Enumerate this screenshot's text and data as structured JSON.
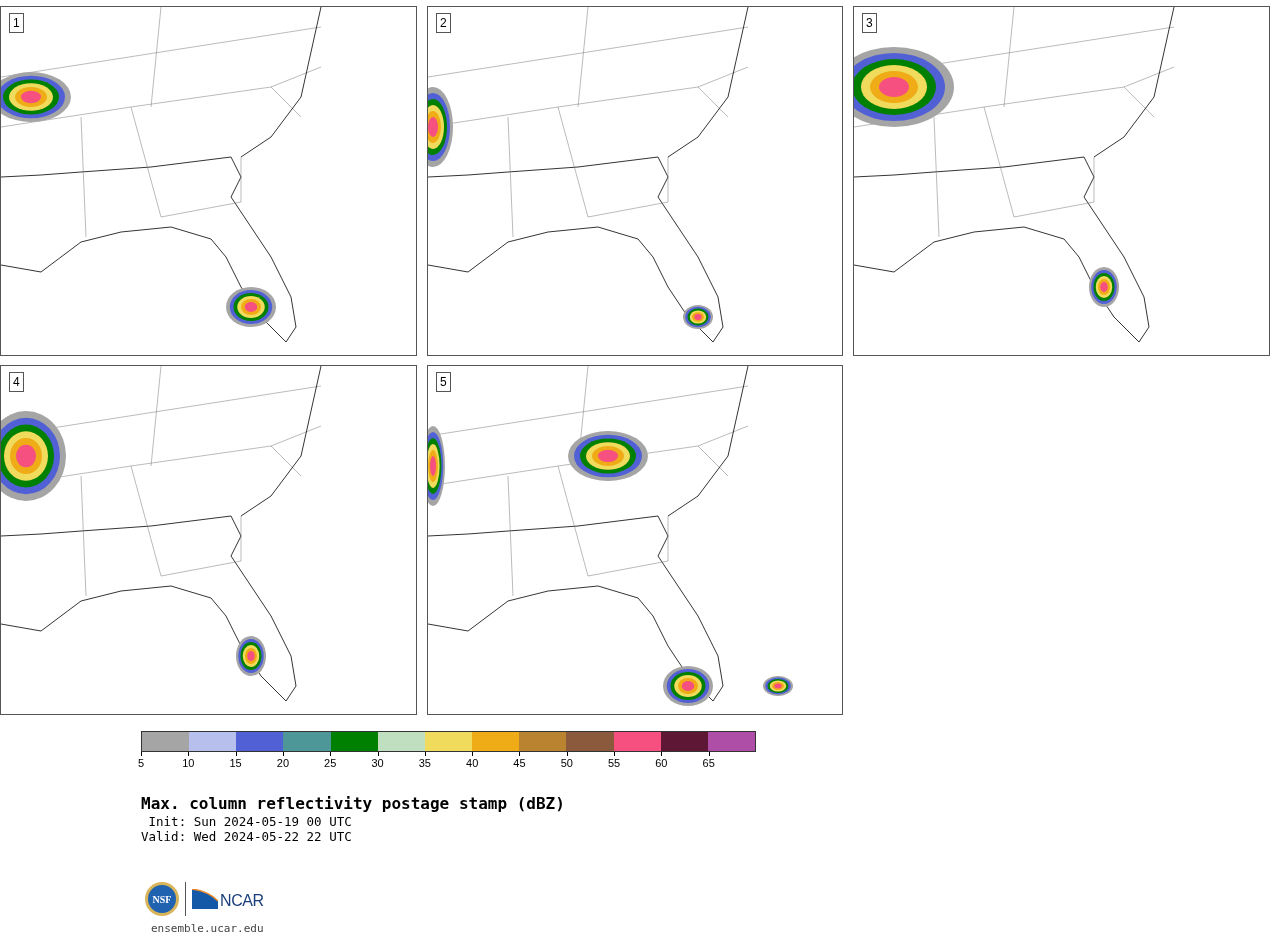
{
  "panels": [
    {
      "label": "1"
    },
    {
      "label": "2"
    },
    {
      "label": "3"
    },
    {
      "label": "4"
    },
    {
      "label": "5"
    }
  ],
  "colorbar": {
    "bins": [
      {
        "color": "#a5a5a5"
      },
      {
        "color": "#b7c0ec"
      },
      {
        "color": "#5260d6"
      },
      {
        "color": "#4e9799"
      },
      {
        "color": "#008000"
      },
      {
        "color": "#bfdfc0"
      },
      {
        "color": "#f1db5c"
      },
      {
        "color": "#efac17"
      },
      {
        "color": "#ba8330"
      },
      {
        "color": "#8b5a3c"
      },
      {
        "color": "#f65080"
      },
      {
        "color": "#5f1736"
      },
      {
        "color": "#ae4ea6"
      }
    ],
    "ticks": [
      "5",
      "10",
      "15",
      "20",
      "25",
      "30",
      "35",
      "40",
      "45",
      "50",
      "55",
      "60",
      "65"
    ]
  },
  "title": "Max. column reflectivity postage stamp (dBZ)",
  "init": " Init: Sun 2024-05-19 00 UTC",
  "valid": "Valid: Wed 2024-05-22 22 UTC",
  "logos": {
    "nsf": "NSF",
    "ncar": "NCAR"
  },
  "footer_link": "ensemble.ucar.edu"
}
